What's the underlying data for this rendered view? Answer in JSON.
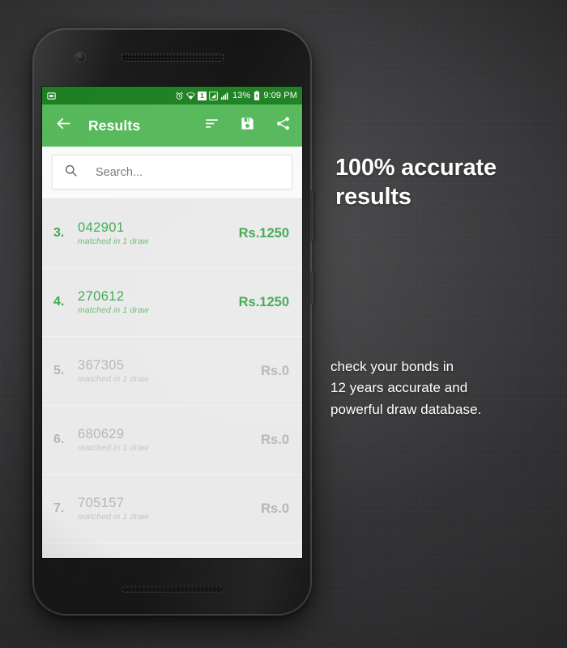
{
  "status_bar": {
    "notification_icon": "screenshot-icon",
    "icons": [
      "alarm-icon",
      "wifi-icon",
      "sim-1-icon",
      "signal-bars-icon",
      "signal-strength-icon"
    ],
    "sim_label": "1",
    "battery_percent": "13%",
    "battery_icon": "battery-charging-icon",
    "clock": "9:09 PM",
    "background_color": "#1e8023"
  },
  "app_bar": {
    "back_icon": "back-arrow-icon",
    "title": "Results",
    "actions": [
      {
        "name": "sort-icon",
        "label": "Sort"
      },
      {
        "name": "save-icon",
        "label": "Save"
      },
      {
        "name": "share-icon",
        "label": "Share"
      }
    ],
    "background_color": "#57b85b"
  },
  "search": {
    "icon": "search-icon",
    "placeholder": "Search...",
    "value": ""
  },
  "results": {
    "rows": [
      {
        "index": "3.",
        "number": "042901",
        "subtitle": "matched in 1 draw",
        "amount": "Rs.1250",
        "state": "matched"
      },
      {
        "index": "4.",
        "number": "270612",
        "subtitle": "matched in 1 draw",
        "amount": "Rs.1250",
        "state": "matched"
      },
      {
        "index": "5.",
        "number": "367305",
        "subtitle": "matched in 1 draw",
        "amount": "Rs.0",
        "state": "unmatched"
      },
      {
        "index": "6.",
        "number": "680629",
        "subtitle": "matched in 1 draw",
        "amount": "Rs.0",
        "state": "unmatched"
      },
      {
        "index": "7.",
        "number": "705157",
        "subtitle": "matched in 1 draw",
        "amount": "Rs.0",
        "state": "unmatched"
      }
    ],
    "matched_color": "#3faa51",
    "unmatched_color": "#b6b6b6"
  },
  "promo": {
    "headline": "100% accurate results",
    "body_lines": [
      "check your bonds in",
      "12 years accurate and",
      "powerful draw database."
    ]
  }
}
